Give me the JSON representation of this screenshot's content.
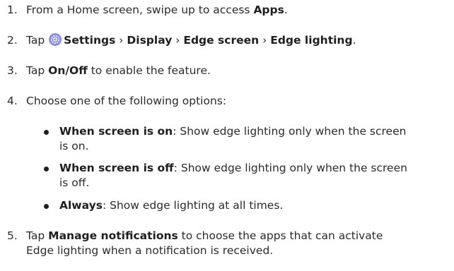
{
  "steps": [
    {
      "num": "1.",
      "before": "From a Home screen, swipe up to access ",
      "bold": "Apps",
      "after": "."
    },
    {
      "num": "2.",
      "tap": "Tap ",
      "settings": "Settings",
      "sep1": " › ",
      "display": "Display",
      "sep2": " › ",
      "edge_screen": "Edge screen",
      "sep3": " › ",
      "edge_lighting": "Edge lighting",
      "after": "."
    },
    {
      "num": "3.",
      "before": "Tap ",
      "bold": "On/Off",
      "after": " to enable the feature."
    },
    {
      "num": "4.",
      "text": "Choose one of the following options:"
    },
    {
      "num": "5.",
      "before": "Tap ",
      "bold": "Manage notifications",
      "after": " to choose the apps that can activate",
      "line2": "Edge lighting when a notification is received."
    }
  ],
  "options": [
    {
      "bold": "When screen is on",
      "text": ": Show edge lighting only when the screen",
      "line2": "is on."
    },
    {
      "bold": "When screen is off",
      "text": ": Show edge lighting only when the screen",
      "line2": "is off."
    },
    {
      "bold": "Always",
      "text": ": Show edge lighting at all times.",
      "line2": ""
    }
  ],
  "icon": {
    "name": "settings-gear-icon",
    "color": "#7b7fd6"
  }
}
